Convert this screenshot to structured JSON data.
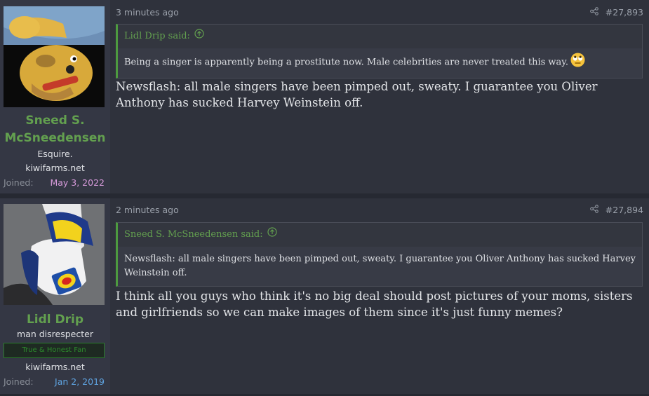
{
  "posts": [
    {
      "user": {
        "name_line1": "Sneed S.",
        "name_line2": "McSneedensen",
        "title": "Esquire.",
        "site": "kiwifarms.net",
        "joined_label": "Joined:",
        "joined_date": "May 3, 2022",
        "joined_color": "#d79bdb"
      },
      "time": "3 minutes ago",
      "number": "#27,893",
      "quote": {
        "author": "Lidl Drip said:",
        "text": "Being a singer is apparently being a prostitute now. Male celebrities are never treated this way.",
        "emoji": "rolling-eyes-emoji"
      },
      "message": "Newsflash: all male singers have been pimped out, sweaty. I guarantee you Oliver Anthony has sucked Harvey Weinstein off."
    },
    {
      "user": {
        "name": "Lidl Drip",
        "title": "man disrespecter",
        "banner": "True & Honest Fan",
        "site": "kiwifarms.net",
        "joined_label": "Joined:",
        "joined_date": "Jan 2, 2019",
        "joined_color": "#5fa3e0"
      },
      "time": "2 minutes ago",
      "number": "#27,894",
      "quote": {
        "author": "Sneed S. McSneedensen said:",
        "text": "Newsflash: all male singers have been pimped out, sweaty. I guarantee you Oliver Anthony has sucked Harvey Weinstein off."
      },
      "message": "I think all you guys who think it's no big deal should post pictures of your moms, sisters and girlfriends so we can make images of them since it's just funny memes?"
    }
  ]
}
